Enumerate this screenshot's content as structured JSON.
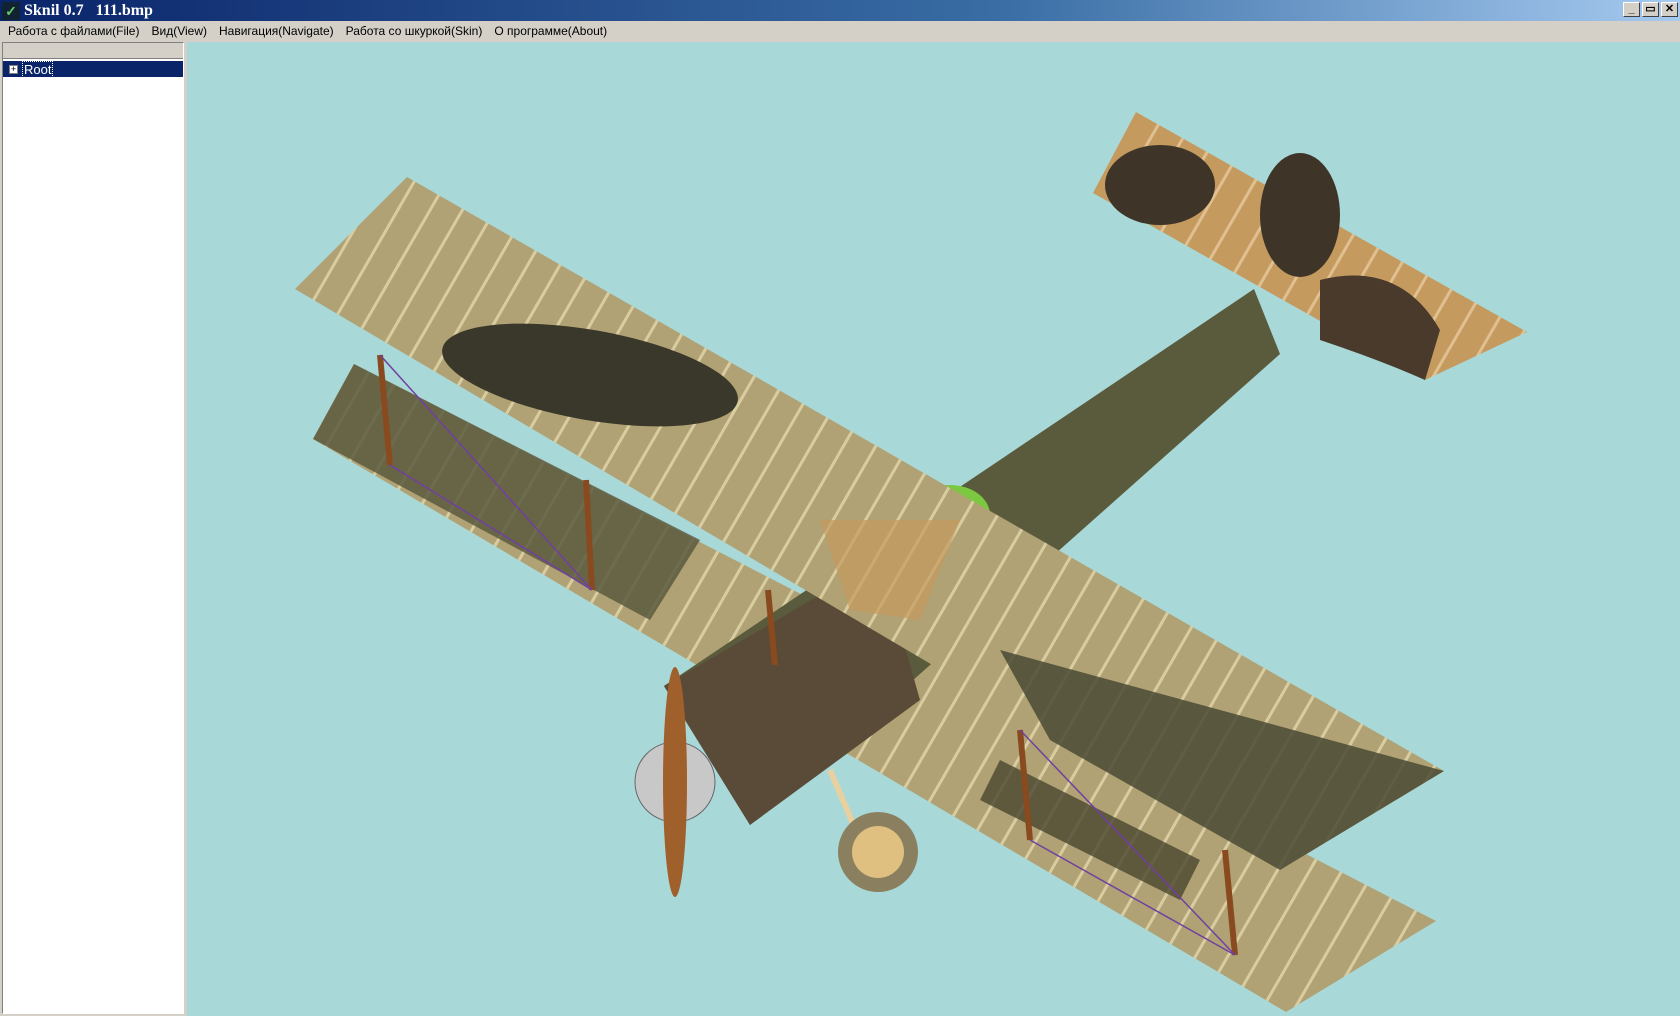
{
  "window": {
    "title": "Sknil 0.7   111.bmp",
    "buttons": {
      "minimize": "_",
      "restore": "▭",
      "close": "✕"
    }
  },
  "menu": [
    "Работа с файлами(File)",
    "Вид(View)",
    "Навигация(Navigate)",
    "Работа со шкуркой(Skin)",
    "О программе(About)"
  ],
  "tree": {
    "root_label": "Root",
    "expander": "+"
  },
  "colors": {
    "viewport": "#a8d8d8",
    "wing_tan": "#b0a274",
    "camo_dark": "#4a4630",
    "fuselage": "#5a4a38"
  }
}
